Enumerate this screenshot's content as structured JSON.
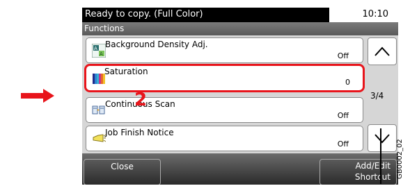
{
  "status": {
    "message": "Ready to copy. (Full Color)",
    "time": "10:10"
  },
  "header": {
    "title": "Functions"
  },
  "rows": [
    {
      "label": "Background Density Adj.",
      "value": "Off",
      "icon": "background-density-icon"
    },
    {
      "label": "Saturation",
      "value": "0",
      "icon": "saturation-icon",
      "selected": true
    },
    {
      "label": "Continuous Scan",
      "value": "Off",
      "icon": "continuous-scan-icon"
    },
    {
      "label": "Job Finish Notice",
      "value": "Off",
      "icon": "job-finish-notice-icon"
    }
  ],
  "pager": {
    "current": "3/4"
  },
  "buttons": {
    "close": "Close",
    "shortcut_line1": "Add/Edit",
    "shortcut_line2": "Shortcut"
  },
  "annotations": {
    "step": "2",
    "figure_code": "GB0002_02"
  },
  "colors": {
    "callout_red": "#e8141b",
    "header_gray": "#6a6a6a",
    "list_bg": "#d6d6d6"
  }
}
